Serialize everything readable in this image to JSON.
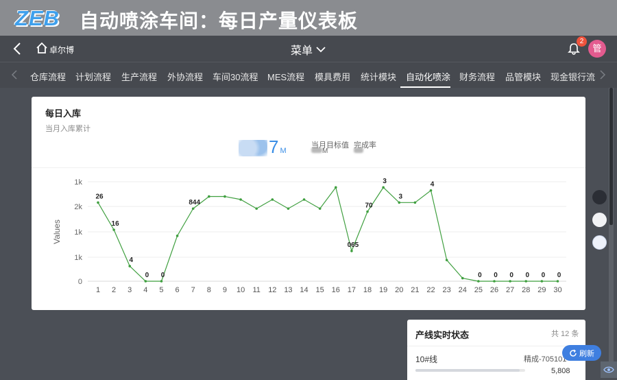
{
  "banner": {
    "logo": "ZEB",
    "title": "自动喷涂车间：每日产量仪表板"
  },
  "header": {
    "home_label": "卓尔博",
    "menu_label": "菜单",
    "notification_count": "2",
    "avatar_text": "管"
  },
  "tabs": [
    "仓库流程",
    "计划流程",
    "生产流程",
    "外协流程",
    "车间30流程",
    "MES流程",
    "模具费用",
    "统计模块",
    "自动化喷涂",
    "财务流程",
    "品管模块",
    "现金银行流"
  ],
  "active_tab": "自动化喷涂",
  "card": {
    "title": "每日入库",
    "subtitle": "当月入库累计",
    "big_number": "7",
    "big_unit": "M",
    "target_label": "当月目标值",
    "target_unit": "M",
    "completion_label": "完成率"
  },
  "chart_data": {
    "type": "line",
    "ylabel": "Values",
    "x": [
      1,
      2,
      3,
      4,
      5,
      6,
      7,
      8,
      9,
      10,
      11,
      12,
      13,
      14,
      15,
      16,
      17,
      18,
      19,
      20,
      21,
      22,
      23,
      24,
      25,
      26,
      27,
      28,
      29,
      30
    ],
    "values": [
      2.6,
      1.7,
      0.5,
      0,
      0,
      1.5,
      2.4,
      2.8,
      2.8,
      2.7,
      2.4,
      2.7,
      2.4,
      2.7,
      2.4,
      3.1,
      1.0,
      2.3,
      3.1,
      2.6,
      2.6,
      3.0,
      0.7,
      0.1,
      0,
      0,
      0,
      0,
      0,
      0
    ],
    "y_ticks": [
      "0",
      "1k",
      "1k",
      "2k",
      "1k"
    ],
    "data_labels": [
      "26",
      "16",
      "4",
      "0",
      "0",
      "",
      "844",
      "",
      "",
      "",
      "",
      "",
      "",
      "",
      "",
      "",
      "065",
      "70",
      "3",
      "3",
      "",
      "4",
      "",
      "",
      "0",
      "0",
      "0",
      "0",
      "0",
      "0"
    ],
    "line_color": "#3f9f3f",
    "grid": true
  },
  "status": {
    "title": "产线实时状态",
    "count": "共 12 条",
    "line_name": "10#线",
    "product": "精成-705101",
    "quantity": "5,808",
    "progress": 0.95
  },
  "refresh_label": "刷新",
  "colors": {
    "accent": "#3a8ee6",
    "badge": "#f0523c",
    "avatar": "#e35b8f",
    "refresh": "#3f7fe0"
  }
}
